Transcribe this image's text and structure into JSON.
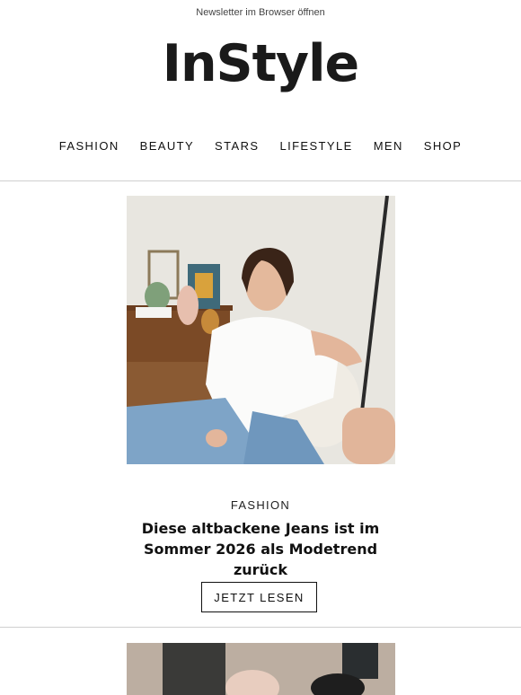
{
  "header": {
    "browser_link": "Newsletter im Browser öffnen",
    "logo": "InStyle"
  },
  "nav": {
    "items": [
      "FASHION",
      "BEAUTY",
      "STARS",
      "LIFESTYLE",
      "MEN",
      "SHOP"
    ]
  },
  "article": {
    "category": "FASHION",
    "headline": "Diese altbackene Jeans ist im Sommer 2026 als Modetrend zurück",
    "cta_label": "JETZT LESEN"
  },
  "colors": {
    "text": "#111111",
    "divider": "#cfcfcf",
    "background": "#ffffff"
  }
}
